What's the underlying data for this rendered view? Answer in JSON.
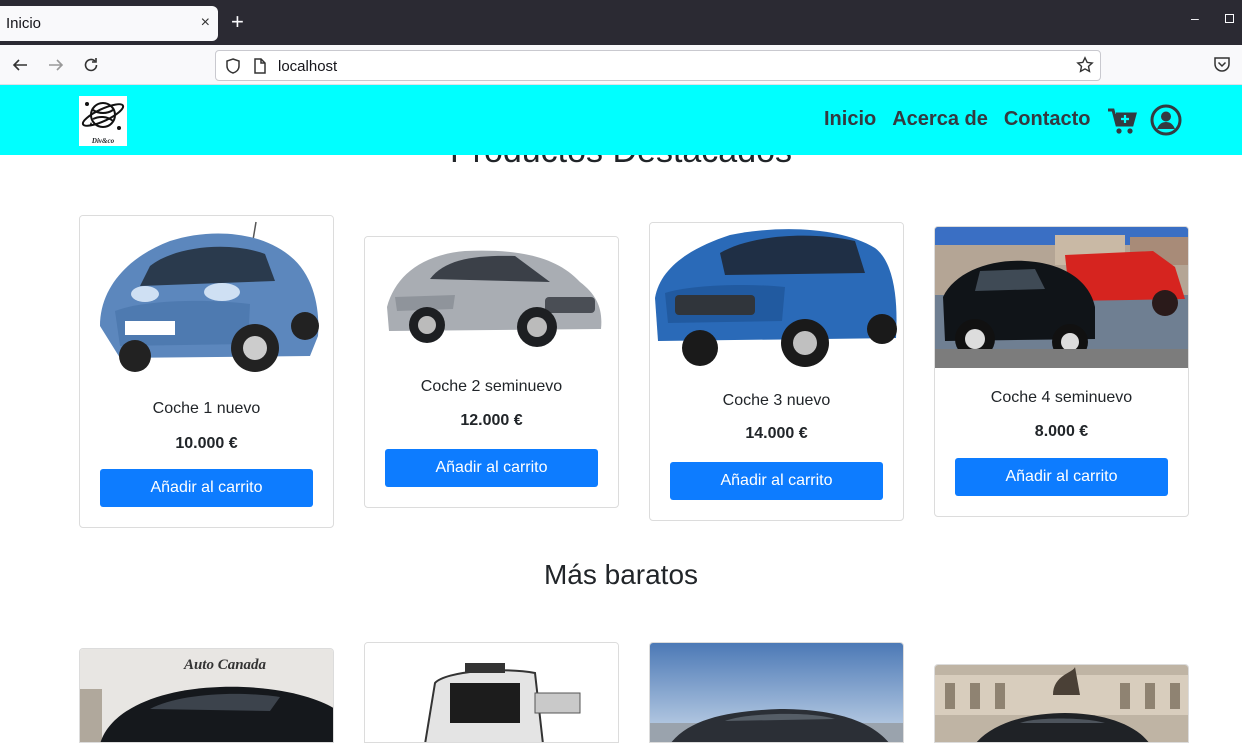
{
  "browser": {
    "tab_title": "Inicio",
    "tab_close": "×",
    "new_tab": "+",
    "minimize": "–",
    "url": "localhost"
  },
  "header": {
    "logo_text": "Div&co",
    "menu": [
      {
        "label": "Inicio"
      },
      {
        "label": "Acerca de"
      },
      {
        "label": "Contacto"
      }
    ]
  },
  "featured": {
    "heading": "Productos Destacados",
    "products": [
      {
        "name": "Coche 1 nuevo",
        "price": "10.000 €",
        "button": "Añadir al carrito"
      },
      {
        "name": "Coche 2 seminuevo",
        "price": "12.000 €",
        "button": "Añadir al carrito"
      },
      {
        "name": "Coche 3 nuevo",
        "price": "14.000 €",
        "button": "Añadir al carrito"
      },
      {
        "name": "Coche 4 seminuevo",
        "price": "8.000 €",
        "button": "Añadir al carrito"
      }
    ]
  },
  "cheap": {
    "title": "Más baratos",
    "first_image_sign": "Auto Canada"
  },
  "colors": {
    "header_bg": "#00ffff",
    "button_bg": "#0d7cff"
  }
}
